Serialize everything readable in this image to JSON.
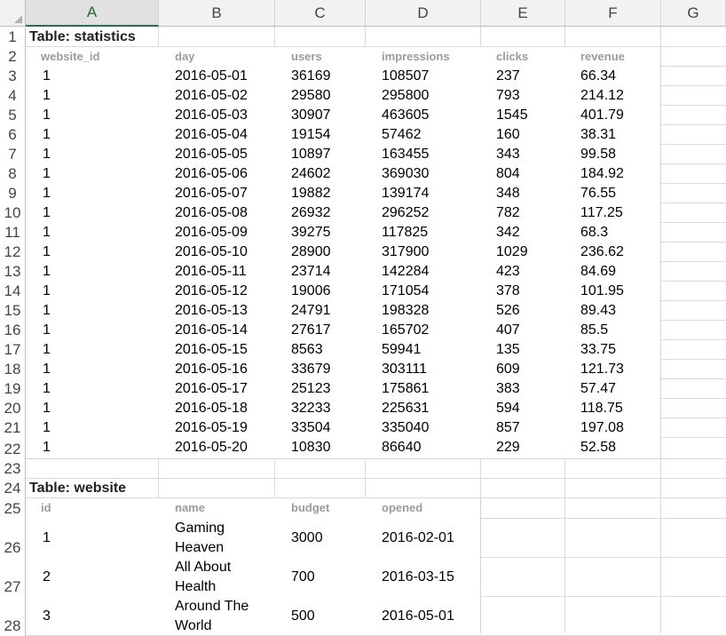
{
  "columns": [
    "A",
    "B",
    "C",
    "D",
    "E",
    "F",
    "G"
  ],
  "rows": [
    "1",
    "2",
    "3",
    "4",
    "5",
    "6",
    "7",
    "8",
    "9",
    "10",
    "11",
    "12",
    "13",
    "14",
    "15",
    "16",
    "17",
    "18",
    "19",
    "20",
    "21",
    "22",
    "23",
    "24",
    "25",
    "26",
    "27",
    "28"
  ],
  "statistics": {
    "title": "Table: statistics",
    "headers": [
      "website_id",
      "day",
      "users",
      "impressions",
      "clicks",
      "revenue"
    ],
    "data": [
      [
        "1",
        "2016-05-01",
        "36169",
        "108507",
        "237",
        "66.34"
      ],
      [
        "1",
        "2016-05-02",
        "29580",
        "295800",
        "793",
        "214.12"
      ],
      [
        "1",
        "2016-05-03",
        "30907",
        "463605",
        "1545",
        "401.79"
      ],
      [
        "1",
        "2016-05-04",
        "19154",
        "57462",
        "160",
        "38.31"
      ],
      [
        "1",
        "2016-05-05",
        "10897",
        "163455",
        "343",
        "99.58"
      ],
      [
        "1",
        "2016-05-06",
        "24602",
        "369030",
        "804",
        "184.92"
      ],
      [
        "1",
        "2016-05-07",
        "19882",
        "139174",
        "348",
        "76.55"
      ],
      [
        "1",
        "2016-05-08",
        "26932",
        "296252",
        "782",
        "117.25"
      ],
      [
        "1",
        "2016-05-09",
        "39275",
        "117825",
        "342",
        "68.3"
      ],
      [
        "1",
        "2016-05-10",
        "28900",
        "317900",
        "1029",
        "236.62"
      ],
      [
        "1",
        "2016-05-11",
        "23714",
        "142284",
        "423",
        "84.69"
      ],
      [
        "1",
        "2016-05-12",
        "19006",
        "171054",
        "378",
        "101.95"
      ],
      [
        "1",
        "2016-05-13",
        "24791",
        "198328",
        "526",
        "89.43"
      ],
      [
        "1",
        "2016-05-14",
        "27617",
        "165702",
        "407",
        "85.5"
      ],
      [
        "1",
        "2016-05-15",
        "8563",
        "59941",
        "135",
        "33.75"
      ],
      [
        "1",
        "2016-05-16",
        "33679",
        "303111",
        "609",
        "121.73"
      ],
      [
        "1",
        "2016-05-17",
        "25123",
        "175861",
        "383",
        "57.47"
      ],
      [
        "1",
        "2016-05-18",
        "32233",
        "225631",
        "594",
        "118.75"
      ],
      [
        "1",
        "2016-05-19",
        "33504",
        "335040",
        "857",
        "197.08"
      ],
      [
        "1",
        "2016-05-20",
        "10830",
        "86640",
        "229",
        "52.58"
      ]
    ]
  },
  "website": {
    "title": "Table: website",
    "headers": [
      "id",
      "name",
      "budget",
      "opened"
    ],
    "data": [
      [
        "1",
        "Gaming Heaven",
        "3000",
        "2016-02-01"
      ],
      [
        "2",
        "All About Health",
        "700",
        "2016-03-15"
      ],
      [
        "3",
        "Around The World",
        "500",
        "2016-05-01"
      ]
    ]
  }
}
